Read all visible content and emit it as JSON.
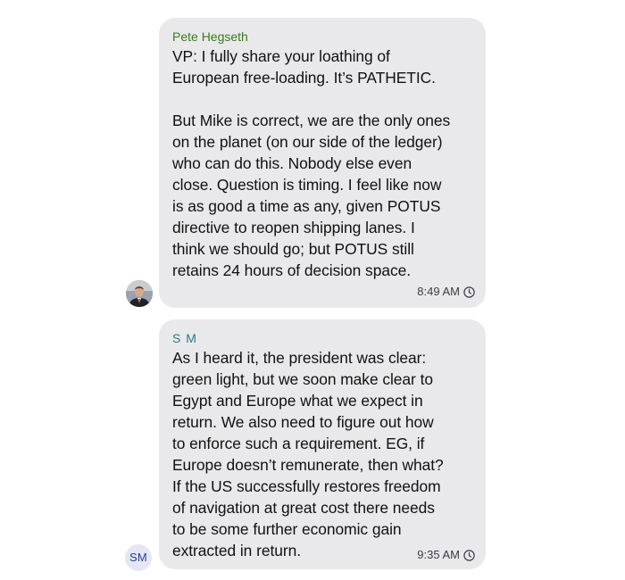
{
  "messages": [
    {
      "sender": "Pete Hegseth",
      "sender_color": "#3a7a1f",
      "text": "VP: I fully share your loathing of\nEuropean free-loading. It’s PATHETIC.\n\nBut Mike is correct, we are the only ones\non the planet (on our side of the ledger)\nwho can do this. Nobody else even\nclose. Question is timing. I feel like now\nis as good a time as any, given POTUS\ndirective to reopen shipping lanes. I\nthink we should go; but POTUS still\nretains 24 hours of decision space.",
      "time": "8:49 AM",
      "avatar": "photo-avatar"
    },
    {
      "sender": "S M",
      "sender_color": "#2a7a8a",
      "text": "As I heard it, the president was clear:\ngreen light, but we soon make clear to\nEgypt and Europe what we expect in\nreturn. We also need to figure out how\nto enforce such a requirement. EG, if\nEurope doesn’t remunerate, then what?\nIf the US successfully restores freedom\nof navigation at great cost there needs\nto be some further economic gain\nextracted in return.",
      "time": "9:35 AM",
      "avatar_initials": "SM"
    }
  ],
  "icons": {
    "time": "clock-icon"
  }
}
